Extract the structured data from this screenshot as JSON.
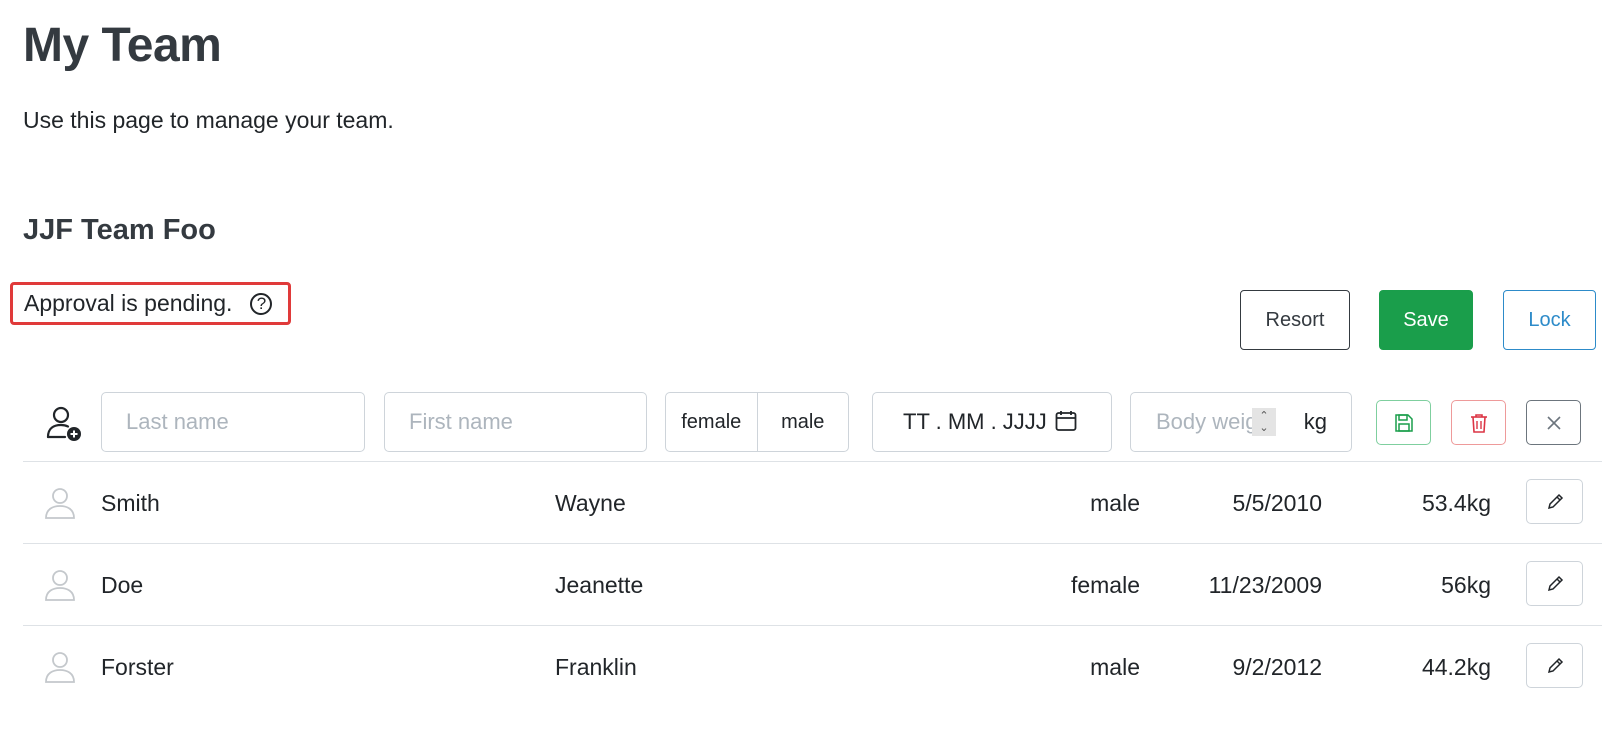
{
  "page": {
    "title": "My Team",
    "subtitle": "Use this page to manage your team."
  },
  "team": {
    "name": "JJF Team Foo",
    "approval_status": "Approval is pending.",
    "help_icon_glyph": "?"
  },
  "toolbar": {
    "resort_label": "Resort",
    "save_label": "Save",
    "lock_label": "Lock"
  },
  "new_member_form": {
    "last_name_placeholder": "Last name",
    "first_name_placeholder": "First name",
    "gender_options": [
      "female",
      "male"
    ],
    "date_placeholder": "TT . MM . JJJJ",
    "weight_placeholder": "Body weight",
    "weight_unit": "kg",
    "icons": {
      "add": "add-user-icon",
      "date": "calendar-icon",
      "save": "save-icon",
      "delete": "trash-icon",
      "cancel": "close-icon"
    }
  },
  "members": [
    {
      "last_name": "Smith",
      "first_name": "Wayne",
      "gender": "male",
      "birthdate": "5/5/2010",
      "weight": "53.4kg"
    },
    {
      "last_name": "Doe",
      "first_name": "Jeanette",
      "gender": "female",
      "birthdate": "11/23/2009",
      "weight": "56kg"
    },
    {
      "last_name": "Forster",
      "first_name": "Franklin",
      "gender": "male",
      "birthdate": "9/2/2012",
      "weight": "44.2kg"
    }
  ],
  "colors": {
    "save_green": "#1a9e4b",
    "lock_blue": "#2d8bc9",
    "highlight_red": "#e03a3a"
  }
}
